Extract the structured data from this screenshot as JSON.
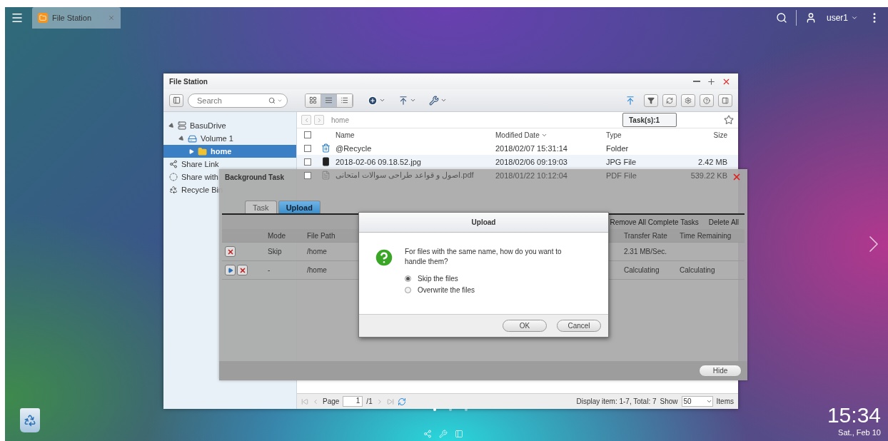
{
  "topbar": {
    "app_tab": {
      "title": "File Station"
    },
    "user": "user1"
  },
  "desktop": {
    "clock": "15:34",
    "date": "Sat., Feb 10",
    "page_dots": [
      {
        "selected": true
      },
      {
        "selected": false
      },
      {
        "selected": false
      }
    ]
  },
  "file_station": {
    "title": "File Station",
    "search": {
      "placeholder": "Search"
    },
    "view_modes": [
      {
        "kind": "grid",
        "selected": false
      },
      {
        "kind": "list",
        "selected": true
      },
      {
        "kind": "detail",
        "selected": false
      }
    ],
    "tooltip": "Task(s):1",
    "tree": [
      {
        "label": "BasuDrive",
        "kind": "nas",
        "expanded": true,
        "children": [
          {
            "label": "Volume 1",
            "kind": "volume",
            "expanded": true,
            "children": [
              {
                "label": "home",
                "kind": "folder",
                "selected": true
              }
            ]
          }
        ]
      },
      {
        "label": "Share Link",
        "kind": "share"
      },
      {
        "label": "Share with",
        "kind": "shared"
      },
      {
        "label": "Recycle Bin",
        "kind": "recycle"
      }
    ],
    "path": "home",
    "select_all": {
      "checked": false
    },
    "columns": [
      {
        "label": "Name",
        "sorted": false
      },
      {
        "label": "Modified Date",
        "sorted": true
      },
      {
        "label": "Type",
        "sorted": false
      },
      {
        "label": "Size",
        "sorted": false
      }
    ],
    "rows": [
      {
        "kind": "recycle",
        "checked": false,
        "selected": false,
        "dimmed": false,
        "name": "@Recycle",
        "date": "2018/02/07 15:31:14",
        "type": "Folder",
        "size": ""
      },
      {
        "kind": "image",
        "checked": false,
        "selected": true,
        "dimmed": false,
        "name": "2018-02-06 09.18.52.jpg",
        "date": "2018/02/06 09:19:03",
        "type": "JPG File",
        "size": "2.42 MB"
      },
      {
        "kind": "pdf",
        "checked": false,
        "selected": false,
        "dimmed": true,
        "name": "اصول و قواعد طراحی سوالات امتحانی.pdf",
        "date": "2018/01/22 10:12:04",
        "type": "PDF File",
        "size": "539.22 KB"
      }
    ],
    "pager": {
      "page_label": "Page",
      "page": "1",
      "total_pages": "/1",
      "display": "Display item: 1-7, Total: 7",
      "show_label": "Show",
      "per_page": "50",
      "items_label": "Items"
    }
  },
  "background_task": {
    "title": "Background Task",
    "tabs": [
      {
        "label": "Task",
        "selected": false
      },
      {
        "label": "Upload",
        "selected": true
      }
    ],
    "actions": [
      "Remove All Complete Tasks",
      "Delete All"
    ],
    "columns": [
      "Mode",
      "File Path",
      "Transfer Rate",
      "Time Remaining"
    ],
    "rows": [
      {
        "can_resume": false,
        "mode": "Skip",
        "path": "/home",
        "rate": "2.31 MB/Sec.",
        "remaining": ""
      },
      {
        "can_resume": true,
        "mode": "-",
        "path": "/home",
        "rate": "Calculating",
        "remaining": "Calculating"
      }
    ],
    "hide_button": "Hide"
  },
  "upload_dialog": {
    "title": "Upload",
    "message": "For files with the same name, how do you want to handle them?",
    "options": [
      {
        "label": "Skip the files",
        "selected": true
      },
      {
        "label": "Overwrite the files",
        "selected": false
      }
    ],
    "buttons": [
      "OK",
      "Cancel"
    ]
  }
}
